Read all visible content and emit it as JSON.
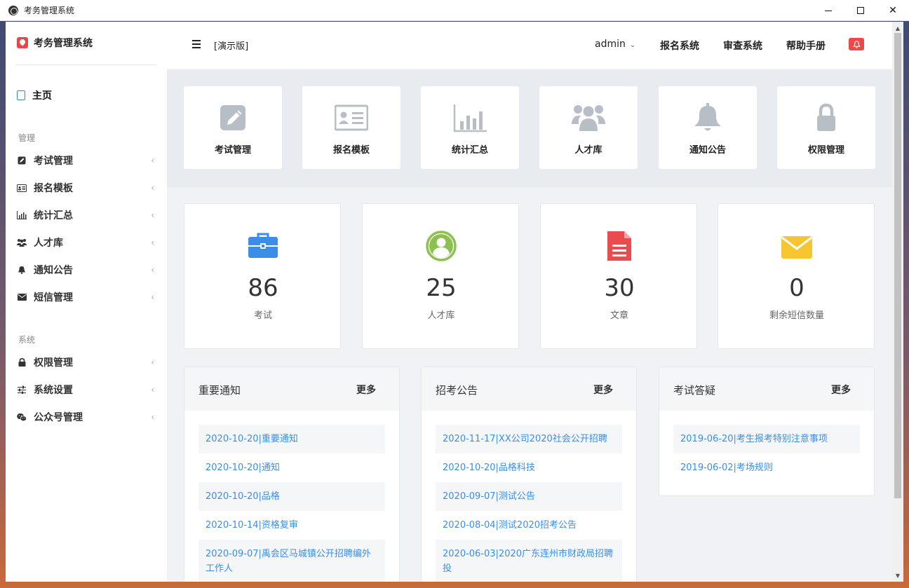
{
  "window": {
    "title": "考务管理系统"
  },
  "sidebar": {
    "brand": "考务管理系统",
    "home": "主页",
    "sections": [
      {
        "label": "管理",
        "items": [
          "考试管理",
          "报名模板",
          "统计汇总",
          "人才库",
          "通知公告",
          "短信管理"
        ]
      },
      {
        "label": "系统",
        "items": [
          "权限管理",
          "系统设置",
          "公众号管理"
        ]
      }
    ]
  },
  "topbar": {
    "demo": "[演示版]",
    "user": "admin",
    "links": [
      "报名系统",
      "审查系统",
      "帮助手册"
    ]
  },
  "quick": [
    {
      "label": "考试管理",
      "icon": "edit-icon"
    },
    {
      "label": "报名模板",
      "icon": "id-card-icon"
    },
    {
      "label": "统计汇总",
      "icon": "bar-chart-icon"
    },
    {
      "label": "人才库",
      "icon": "users-icon"
    },
    {
      "label": "通知公告",
      "icon": "bell-icon"
    },
    {
      "label": "权限管理",
      "icon": "lock-icon"
    }
  ],
  "stats": [
    {
      "value": "86",
      "label": "考试",
      "icon": "briefcase-icon",
      "color": "#3a8ee6"
    },
    {
      "value": "25",
      "label": "人才库",
      "icon": "user-circle-icon",
      "color": "#8cc152"
    },
    {
      "value": "30",
      "label": "文章",
      "icon": "file-icon",
      "color": "#e84c4c"
    },
    {
      "value": "0",
      "label": "剩余短信数量",
      "icon": "envelope-icon",
      "color": "#f6c530"
    }
  ],
  "panels": [
    {
      "title": "重要通知",
      "more": "更多",
      "items": [
        "2020-10-20|重要通知",
        "2020-10-20|通知",
        "2020-10-20|品格",
        "2020-10-14|资格复审",
        "2020-09-07|禹会区马城镇公开招聘编外工作人"
      ]
    },
    {
      "title": "招考公告",
      "more": "更多",
      "items": [
        "2020-11-17|XX公司2020社会公开招聘",
        "2020-10-20|品格科技",
        "2020-09-07|测试公告",
        "2020-08-04|测试2020招考公告",
        "2020-06-03|2020广东连州市财政局招聘投"
      ]
    },
    {
      "title": "考试答疑",
      "more": "更多",
      "items": [
        "2019-06-20|考生报考特别注意事项",
        "2019-06-02|考场规则"
      ]
    }
  ],
  "colors": {
    "accent": "#3a8ee6",
    "danger": "#f04848",
    "icon_gray": "#b8bec6"
  }
}
